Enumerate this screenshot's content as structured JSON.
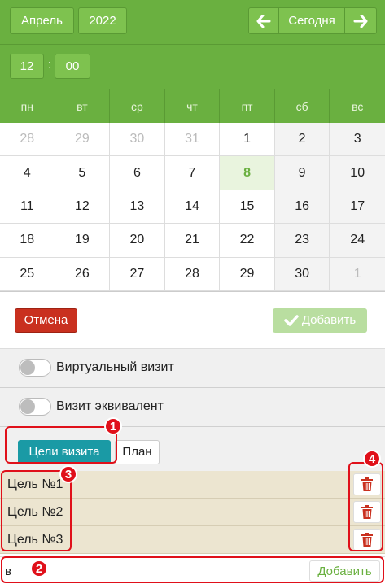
{
  "header": {
    "month": "Апрель",
    "year": "2022",
    "today": "Сегодня"
  },
  "time": {
    "hours": "12",
    "sep": ":",
    "minutes": "00"
  },
  "weekdays": [
    "пн",
    "вт",
    "ср",
    "чт",
    "пт",
    "сб",
    "вс"
  ],
  "days": [
    {
      "d": "28",
      "muted": true
    },
    {
      "d": "29",
      "muted": true
    },
    {
      "d": "30",
      "muted": true
    },
    {
      "d": "31",
      "muted": true
    },
    {
      "d": "1"
    },
    {
      "d": "2"
    },
    {
      "d": "3"
    },
    {
      "d": "4"
    },
    {
      "d": "5"
    },
    {
      "d": "6"
    },
    {
      "d": "7"
    },
    {
      "d": "8",
      "today": true
    },
    {
      "d": "9"
    },
    {
      "d": "10"
    },
    {
      "d": "11"
    },
    {
      "d": "12"
    },
    {
      "d": "13"
    },
    {
      "d": "14"
    },
    {
      "d": "15"
    },
    {
      "d": "16"
    },
    {
      "d": "17"
    },
    {
      "d": "18"
    },
    {
      "d": "19"
    },
    {
      "d": "20"
    },
    {
      "d": "21"
    },
    {
      "d": "22"
    },
    {
      "d": "23"
    },
    {
      "d": "24"
    },
    {
      "d": "25"
    },
    {
      "d": "26"
    },
    {
      "d": "27"
    },
    {
      "d": "28"
    },
    {
      "d": "29"
    },
    {
      "d": "30"
    },
    {
      "d": "1",
      "muted": true
    }
  ],
  "actions": {
    "cancel": "Отмена",
    "add": "Добавить"
  },
  "toggles": {
    "virtual": "Виртуальный визит",
    "equivalent": "Визит эквивалент"
  },
  "tabs": {
    "goals": "Цели визита",
    "plan": "План"
  },
  "goals": [
    "Цель №1",
    "Цель №2",
    "Цель №3"
  ],
  "new_goal": {
    "value": "в",
    "add": "Добавить"
  },
  "annotations": [
    "1",
    "2",
    "3",
    "4"
  ],
  "colors": {
    "green": "#6ab040",
    "teal": "#1a9aa5",
    "red": "#c9301f",
    "annotation": "#e0101a"
  }
}
